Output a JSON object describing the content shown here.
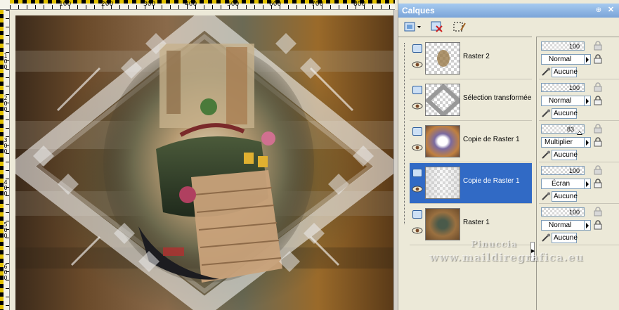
{
  "ruler": {
    "h_labels": [
      "100",
      "200",
      "300",
      "400",
      "500",
      "600",
      "700",
      "800"
    ],
    "v_labels": [
      "1\n0\n0",
      "2\n0\n0",
      "3\n0\n0",
      "4\n0\n0",
      "5\n0\n0",
      "6\n0\n0"
    ]
  },
  "palette": {
    "title": "Calques",
    "toolbar": {
      "new_layer_icon": "new-layer-icon",
      "delete_layer_icon": "delete-layer-icon",
      "edit_selection_icon": "edit-selection-icon"
    },
    "layers": [
      {
        "name": "Raster 2",
        "opacity": "100",
        "blend": "Normal",
        "mask": "Aucune",
        "selected": false
      },
      {
        "name": "Sélection transformée",
        "opacity": "100",
        "blend": "Normal",
        "mask": "Aucune",
        "selected": false
      },
      {
        "name": "Copie de Raster 1",
        "opacity": "83",
        "blend": "Multiplier",
        "mask": "Aucune",
        "selected": false
      },
      {
        "name": "Copie de Raster 1",
        "opacity": "100",
        "blend": "Écran",
        "mask": "Aucune",
        "selected": true
      },
      {
        "name": "Raster 1",
        "opacity": "100",
        "blend": "Normal",
        "mask": "Aucune",
        "selected": false
      }
    ]
  },
  "watermark": {
    "line1": "Pinuccia",
    "line2": "www.maildiregrafica.eu"
  },
  "colors": {
    "titlebar": "#7aa4d8",
    "selected_row": "#316ac5"
  }
}
